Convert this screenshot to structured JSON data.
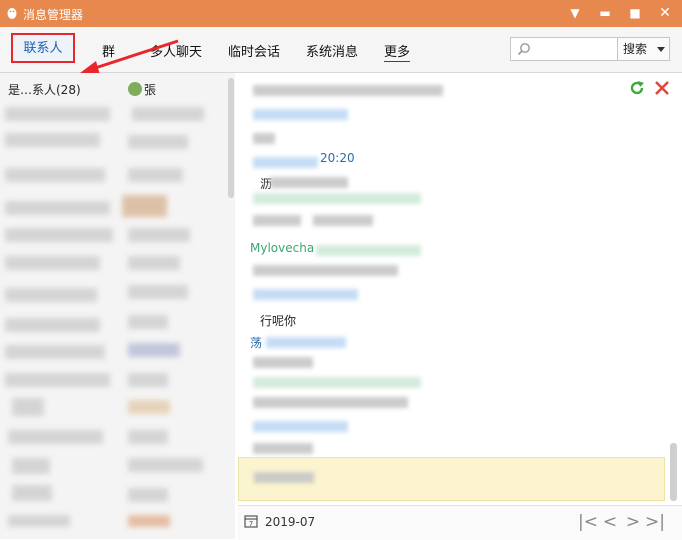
{
  "window": {
    "title": "消息管理器"
  },
  "tabs": [
    {
      "label": "联系人"
    },
    {
      "label": "群"
    },
    {
      "label": "多人聊天"
    },
    {
      "label": "临时会话"
    },
    {
      "label": "系统消息"
    },
    {
      "label": "更多"
    }
  ],
  "search": {
    "value": "",
    "placeholder": "",
    "button_label": "搜索"
  },
  "contacts": {
    "group_label": "是…系人(28)",
    "selected_friend": "張"
  },
  "chat": {
    "timestamp_fragment": "20:20",
    "sender_fragment": "Mylovecha",
    "msg_fragment_1": "沥",
    "msg_fragment_2": "行呢你",
    "msg_fragment_3": "荡"
  },
  "footer": {
    "date_fragment": "2019-07"
  },
  "colors": {
    "titlebar": "#e7884e",
    "active_tab": "#1a62b5",
    "annotation": "#e8262b",
    "highlight": "#fbf4cf"
  }
}
